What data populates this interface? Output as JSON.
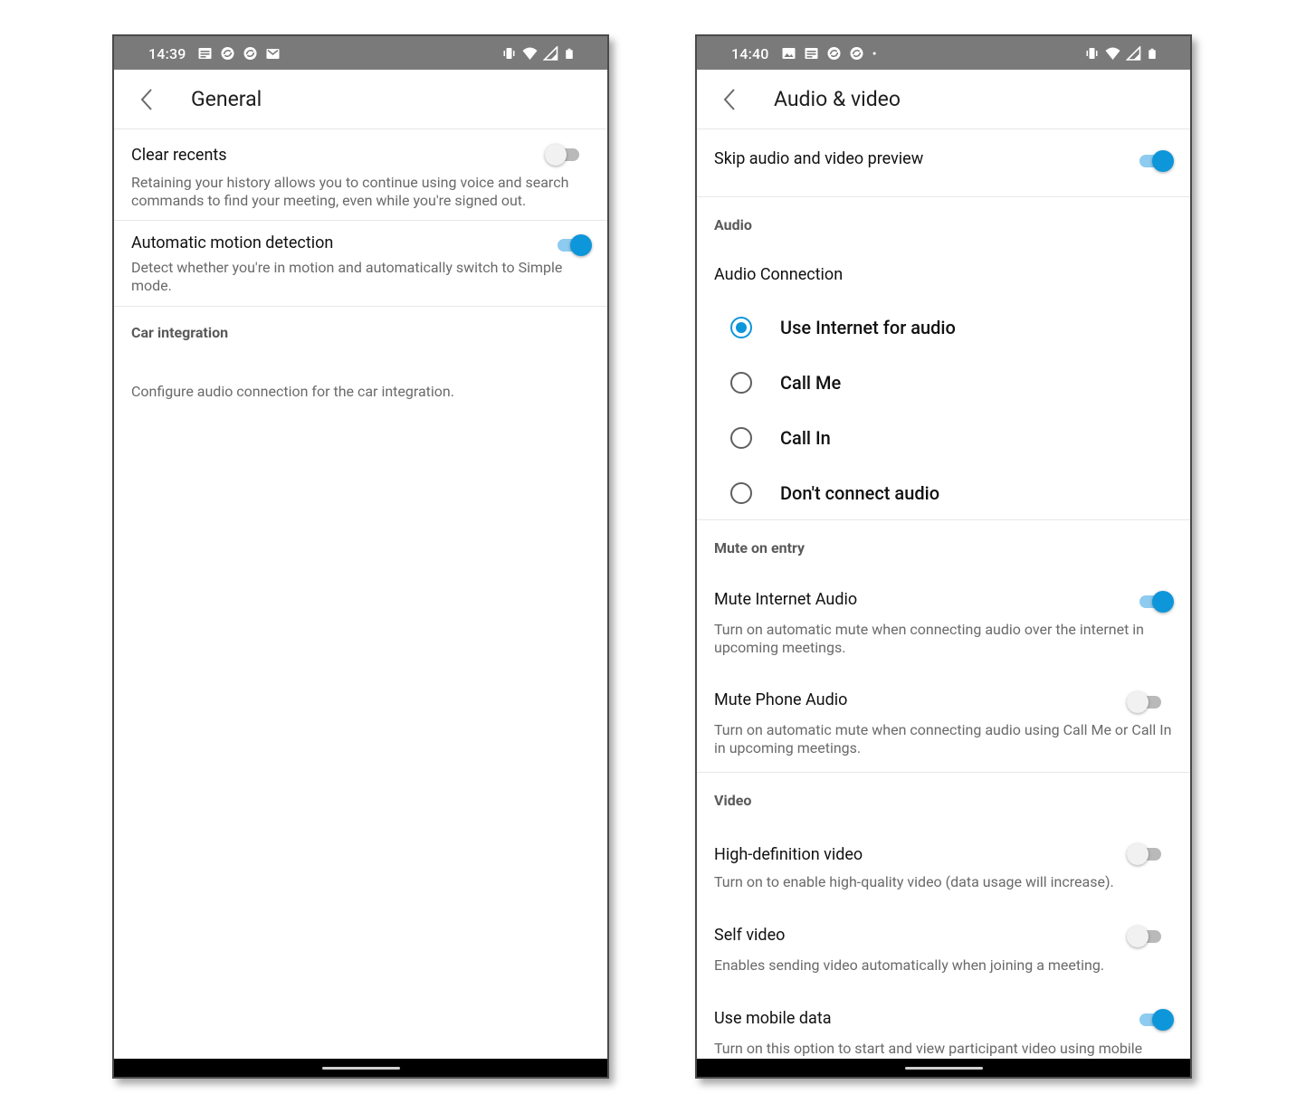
{
  "left": {
    "status": {
      "time": "14:39"
    },
    "title": "General",
    "clear_recents": {
      "title": "Clear recents",
      "desc": "Retaining your history allows you to continue using voice and search commands to find your meeting, even while you're signed out.",
      "on": false
    },
    "motion": {
      "title": "Automatic motion detection",
      "desc": "Detect whether you're in motion and automatically switch to Simple mode.",
      "on": true
    },
    "car_section": "Car integration",
    "car_desc": "Configure audio connection for the car integration."
  },
  "right": {
    "status": {
      "time": "14:40"
    },
    "title": "Audio & video",
    "skip_preview": {
      "title": "Skip audio and video preview",
      "on": true
    },
    "audio_section": "Audio",
    "audio_connection": "Audio Connection",
    "options": [
      {
        "label": "Use Internet for audio",
        "selected": true
      },
      {
        "label": "Call Me",
        "selected": false
      },
      {
        "label": "Call In",
        "selected": false
      },
      {
        "label": "Don't connect audio",
        "selected": false
      }
    ],
    "mute_section": "Mute on entry",
    "mute_internet": {
      "title": "Mute Internet Audio",
      "desc": "Turn on automatic mute when connecting audio over the internet in upcoming meetings.",
      "on": true
    },
    "mute_phone": {
      "title": "Mute Phone Audio",
      "desc": "Turn on automatic mute when connecting audio using Call Me or Call In in upcoming meetings.",
      "on": false
    },
    "video_section": "Video",
    "hd_video": {
      "title": "High-definition video",
      "desc": "Turn on to enable high-quality video (data usage will increase).",
      "on": false
    },
    "self_video": {
      "title": "Self video",
      "desc": "Enables sending video automatically when joining a meeting.",
      "on": false
    },
    "mobile_data": {
      "title": "Use mobile data",
      "desc": "Turn on this option to start and view participant video using mobile",
      "on": true
    }
  },
  "colors": {
    "accent": "#0e96da",
    "statusbar": "#7a7a7a"
  },
  "icons": {
    "left_status": [
      "news-icon",
      "sync-icon",
      "sync-icon",
      "mail-icon"
    ],
    "right_status": [
      "image-icon",
      "news-icon",
      "sync-icon",
      "sync-icon",
      "dot-icon"
    ],
    "system": [
      "vibrate-icon",
      "wifi-icon",
      "signal-icon",
      "battery-icon"
    ]
  }
}
